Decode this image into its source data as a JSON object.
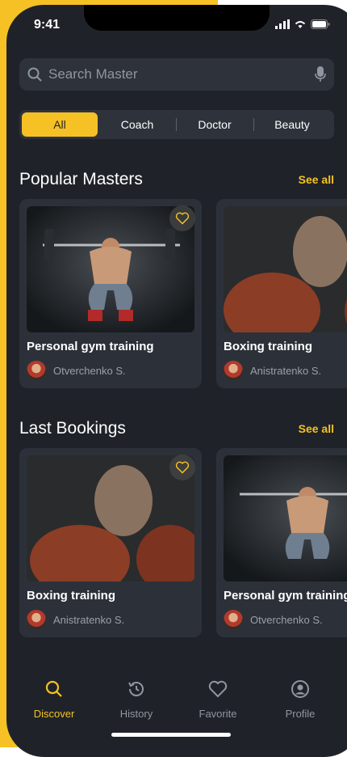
{
  "status_bar": {
    "time": "9:41"
  },
  "search": {
    "placeholder": "Search Master",
    "icon": "search-icon",
    "mic_icon": "microphone-icon"
  },
  "tabs": [
    {
      "label": "All",
      "active": true
    },
    {
      "label": "Coach",
      "active": false
    },
    {
      "label": "Doctor",
      "active": false
    },
    {
      "label": "Beauty",
      "active": false
    }
  ],
  "popular": {
    "title": "Popular Masters",
    "see_all": "See all",
    "cards": [
      {
        "title": "Personal gym training",
        "author": "Otverchenko S.",
        "favorite_icon": "heart-icon"
      },
      {
        "title": "Boxing training",
        "author": "Anistratenko S."
      }
    ]
  },
  "bookings": {
    "title": "Last Bookings",
    "see_all": "See all",
    "cards": [
      {
        "title": "Boxing training",
        "author": "Anistratenko S.",
        "favorite_icon": "heart-icon"
      },
      {
        "title": "Personal gym training",
        "author": "Otverchenko S."
      }
    ]
  },
  "nav": [
    {
      "label": "Discover",
      "icon": "search-icon",
      "active": true
    },
    {
      "label": "History",
      "icon": "history-icon",
      "active": false
    },
    {
      "label": "Favorite",
      "icon": "heart-icon",
      "active": false
    },
    {
      "label": "Profile",
      "icon": "profile-icon",
      "active": false
    }
  ],
  "colors": {
    "accent": "#f5c125",
    "background": "#1f2329",
    "card": "#2c3139",
    "muted_text": "#8f96a0"
  }
}
